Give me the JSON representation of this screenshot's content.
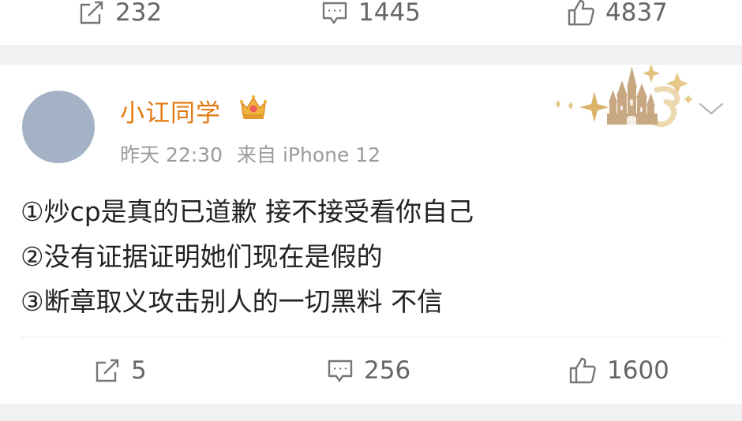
{
  "previous_post": {
    "repost_count": "232",
    "comment_count": "1445",
    "like_count": "4837"
  },
  "post": {
    "username": "小讧同学",
    "time": "昨天 22:30",
    "source": "来自 iPhone 12",
    "lines": [
      "①炒cp是真的已道歉 接不接受看你自己",
      "②没有证据证明她们现在是假的",
      "③断章取义攻击别人的一切黑料 不信"
    ],
    "repost_count": "5",
    "comment_count": "256",
    "like_count": "1600"
  },
  "icons": {
    "repost": "repost-icon",
    "comment": "comment-icon",
    "like": "thumbs-up-icon",
    "vip": "crown-icon",
    "badge": "castle-badge-icon",
    "menu": "chevron-down-icon"
  },
  "colors": {
    "username": "#e07a11",
    "meta": "#9b9b9b",
    "text": "#222222",
    "action": "#666666",
    "separator": "#f1f1f1",
    "avatar": "#a4b2c6"
  }
}
